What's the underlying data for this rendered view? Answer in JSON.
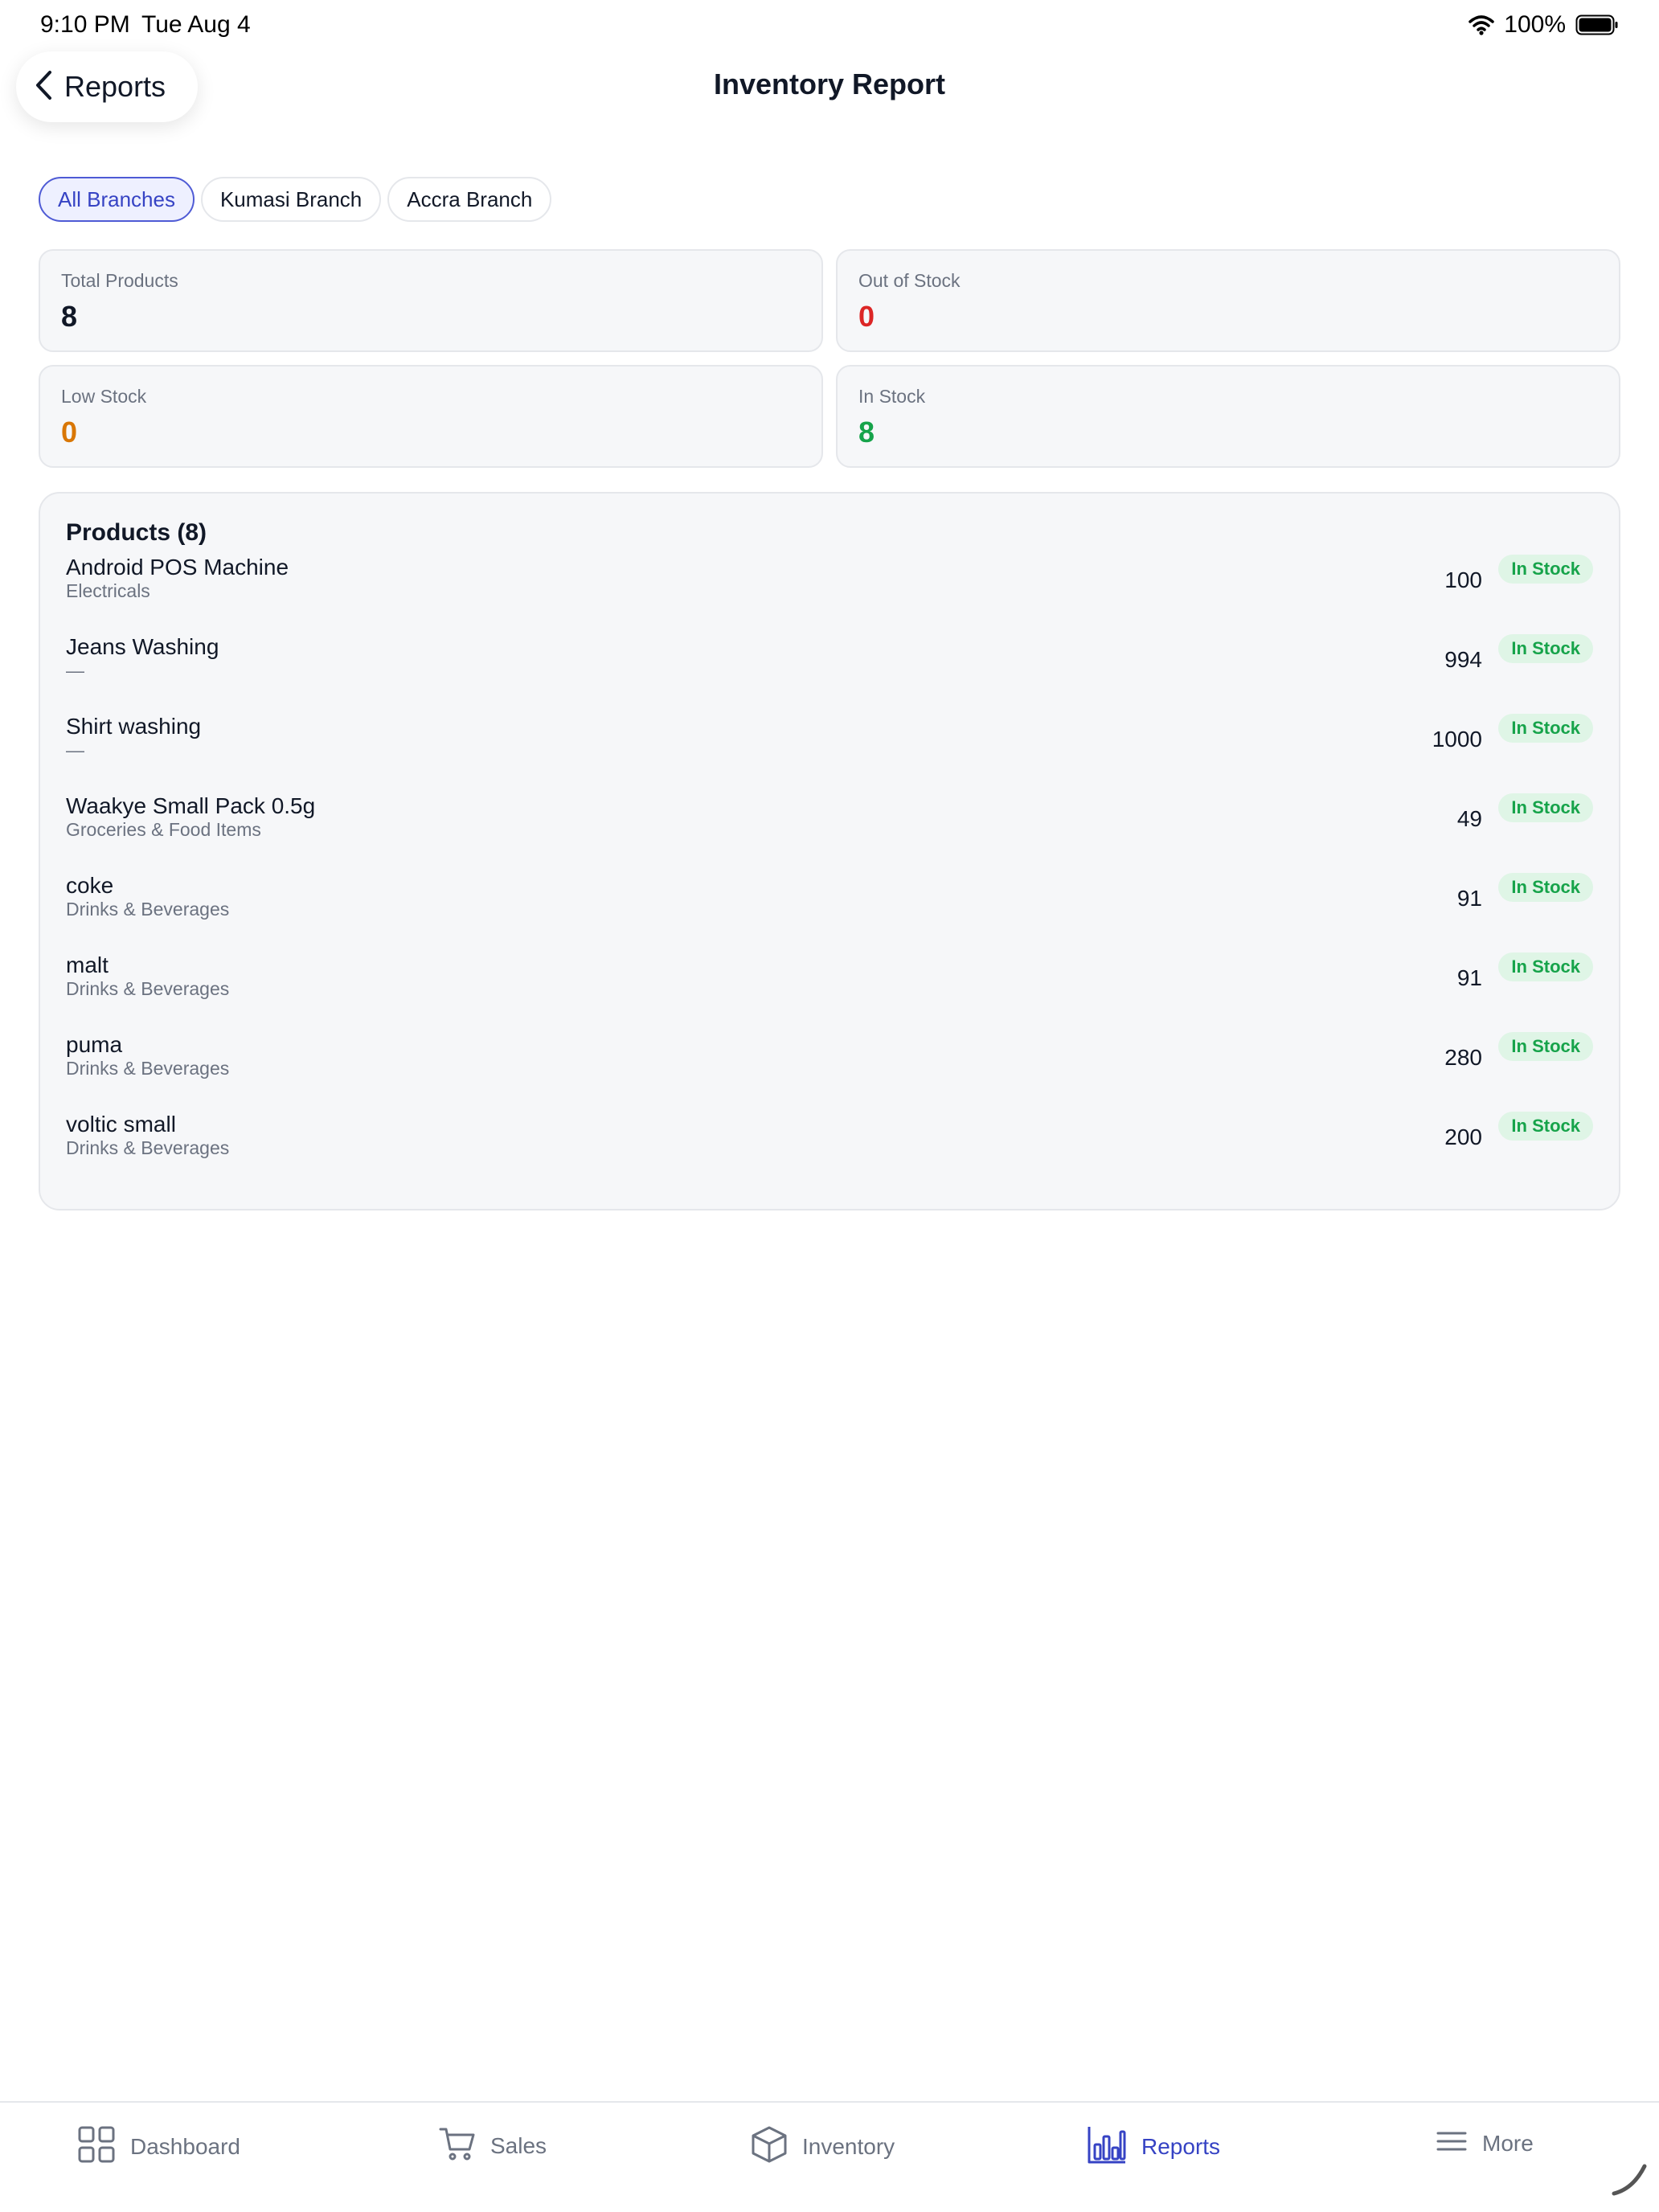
{
  "status_bar": {
    "time": "9:10 PM",
    "date": "Tue Aug 4",
    "battery": "100%"
  },
  "nav": {
    "back_label": "Reports",
    "title": "Inventory Report"
  },
  "branches": [
    {
      "label": "All Branches",
      "active": true
    },
    {
      "label": "Kumasi Branch",
      "active": false
    },
    {
      "label": "Accra Branch",
      "active": false
    }
  ],
  "stats": {
    "total_products": {
      "label": "Total Products",
      "value": "8",
      "color": "#111827"
    },
    "out_of_stock": {
      "label": "Out of Stock",
      "value": "0",
      "color": "#dc2626"
    },
    "low_stock": {
      "label": "Low Stock",
      "value": "0",
      "color": "#d97706"
    },
    "in_stock": {
      "label": "In Stock",
      "value": "8",
      "color": "#16a34a"
    }
  },
  "products": {
    "title": "Products (8)",
    "items": [
      {
        "name": "Android POS Machine",
        "category": "Electricals",
        "qty": "100",
        "status": "In Stock"
      },
      {
        "name": "Jeans Washing",
        "category": "—",
        "qty": "994",
        "status": "In Stock"
      },
      {
        "name": "Shirt washing",
        "category": "—",
        "qty": "1000",
        "status": "In Stock"
      },
      {
        "name": "Waakye Small Pack 0.5g",
        "category": "Groceries & Food Items",
        "qty": "49",
        "status": "In Stock"
      },
      {
        "name": "coke",
        "category": "Drinks & Beverages",
        "qty": "91",
        "status": "In Stock"
      },
      {
        "name": "malt",
        "category": "Drinks & Beverages",
        "qty": "91",
        "status": "In Stock"
      },
      {
        "name": "puma",
        "category": "Drinks & Beverages",
        "qty": "280",
        "status": "In Stock"
      },
      {
        "name": "voltic small",
        "category": "Drinks & Beverages",
        "qty": "200",
        "status": "In Stock"
      }
    ]
  },
  "tab_bar": {
    "dashboard": "Dashboard",
    "sales": "Sales",
    "inventory": "Inventory",
    "reports": "Reports",
    "more": "More",
    "active_tab": "reports"
  },
  "colors": {
    "accent": "#3643c4",
    "success": "#16a34a",
    "danger": "#dc2626",
    "warning": "#d97706"
  }
}
